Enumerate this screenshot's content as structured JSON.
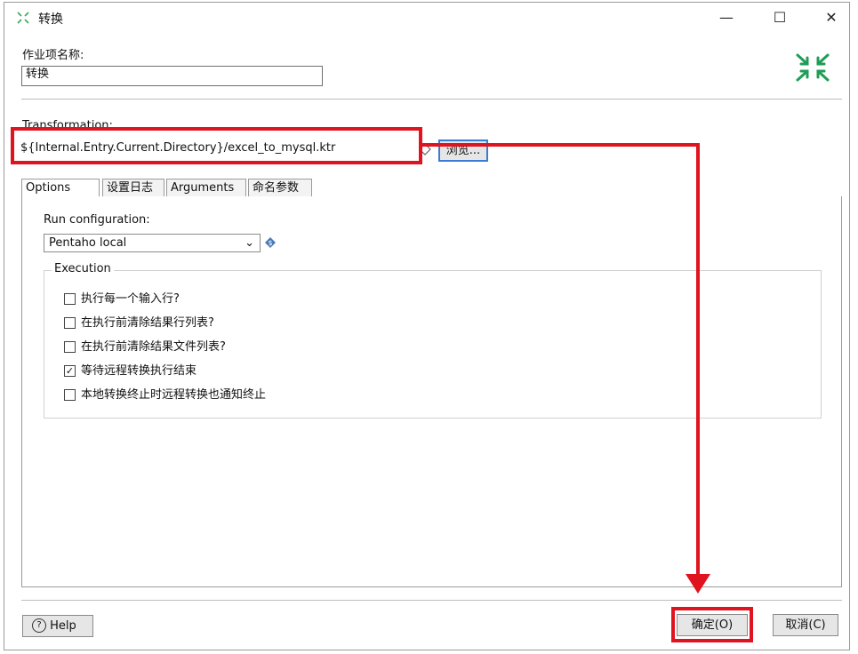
{
  "window": {
    "title": "转换",
    "minimize_glyph": "—",
    "maximize_glyph": "☐",
    "close_glyph": "✕"
  },
  "job_entry": {
    "name_label": "作业项名称:",
    "name_value": "转换"
  },
  "transformation": {
    "label": "Transformation:",
    "path_value": "${Internal.Entry.Current.Directory}/excel_to_mysql.ktr",
    "browse_label": "浏览..."
  },
  "tabs": [
    {
      "label": "Options",
      "active": true
    },
    {
      "label": "设置日志",
      "active": false
    },
    {
      "label": "Arguments",
      "active": false
    },
    {
      "label": "命名参数",
      "active": false
    }
  ],
  "options": {
    "run_config_label": "Run configuration:",
    "run_config_value": "Pentaho local",
    "execution_title": "Execution",
    "checkboxes": [
      {
        "label": "执行每一个输入行?",
        "checked": false
      },
      {
        "label": "在执行前清除结果行列表?",
        "checked": false
      },
      {
        "label": "在执行前清除结果文件列表?",
        "checked": false
      },
      {
        "label": "等待远程转换执行结束",
        "checked": true
      },
      {
        "label": "本地转换终止时远程转换也通知终止",
        "checked": false
      }
    ]
  },
  "footer": {
    "help_label": "Help",
    "ok_label": "确定(O)",
    "cancel_label": "取消(C)"
  },
  "colors": {
    "annotation_red": "#e0141e",
    "brand_green": "#1f9d55",
    "browse_focus_blue": "#3a7bd5"
  }
}
